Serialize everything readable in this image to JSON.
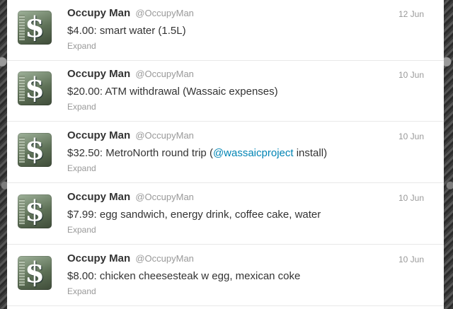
{
  "tweets": [
    {
      "fullname": "Occupy Man",
      "username": "@OccupyMan",
      "time": "12 Jun",
      "text": "$4.00: smart water (1.5L)",
      "expand": "Expand"
    },
    {
      "fullname": "Occupy Man",
      "username": "@OccupyMan",
      "time": "10 Jun",
      "text": "$20.00: ATM withdrawal (Wassaic expenses)",
      "expand": "Expand"
    },
    {
      "fullname": "Occupy Man",
      "username": "@OccupyMan",
      "time": "10 Jun",
      "text_before": "$32.50: MetroNorth round trip (",
      "mention": "@wassaicproject",
      "text_after": " install)",
      "expand": "Expand"
    },
    {
      "fullname": "Occupy Man",
      "username": "@OccupyMan",
      "time": "10 Jun",
      "text": "$7.99: egg sandwich, energy drink, coffee cake, water",
      "expand": "Expand"
    },
    {
      "fullname": "Occupy Man",
      "username": "@OccupyMan",
      "time": "10 Jun",
      "text": "$8.00: chicken cheesesteak w egg, mexican coke",
      "expand": "Expand"
    }
  ],
  "colors": {
    "name": "#333333",
    "meta": "#999999",
    "link": "#0084b4",
    "divider": "#e8e8e8"
  }
}
